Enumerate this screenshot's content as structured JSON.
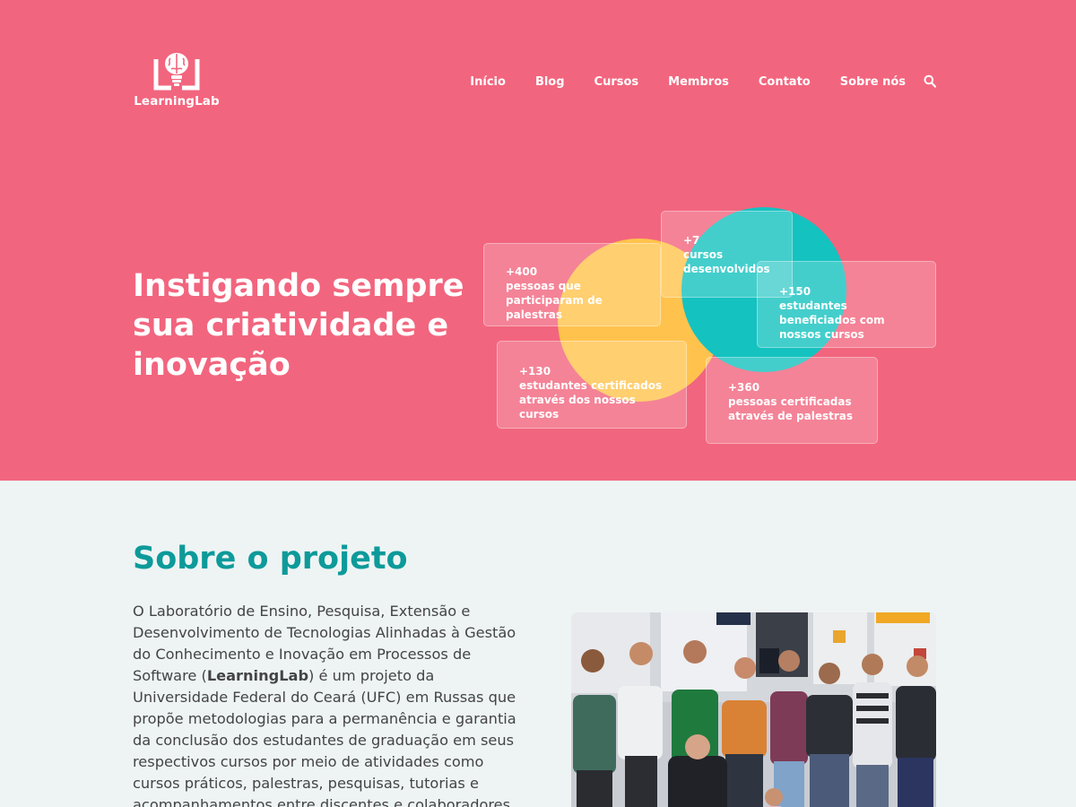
{
  "header": {
    "logo_text": "LearningLab",
    "nav": [
      "Início",
      "Blog",
      "Cursos",
      "Membros",
      "Contato",
      "Sobre nós"
    ]
  },
  "hero": {
    "title": "Instigando sempre sua criatividade e inovação",
    "stats": [
      {
        "num": "+400",
        "label": "pessoas que participaram de palestras"
      },
      {
        "num": "+7",
        "label": "cursos desenvolvidos"
      },
      {
        "num": "+150",
        "label": "estudantes beneficiados com nossos cursos"
      },
      {
        "num": "+130",
        "label": "estudantes certificados através dos nossos cursos"
      },
      {
        "num": "+360",
        "label": "pessoas certificadas através de palestras"
      }
    ]
  },
  "about": {
    "title": "Sobre o projeto",
    "text_before": "O Laboratório de Ensino, Pesquisa, Extensão e Desenvolvimento de Tecnologias Alinhadas à Gestão do Conhecimento e Inovação em Processos de Software (",
    "text_bold": "LearningLab",
    "text_after": ") é um projeto da Universidade Federal do Ceará (UFC) em Russas que propõe metodologias para a permanência e garantia da conclusão dos estudantes de graduação em seus respectivos cursos por meio de atividades como cursos práticos, palestras, pesquisas, tutorias e acompanhamentos entre discentes e colaboradores."
  },
  "colors": {
    "hero_bg": "#f2657e",
    "accent_teal": "#0e9a9a",
    "circle_yellow": "#ffc34d",
    "circle_teal": "#14c2c0",
    "page_bg": "#eef4f4"
  },
  "icons": {
    "logo": "brain-book-icon",
    "search": "search-icon"
  }
}
